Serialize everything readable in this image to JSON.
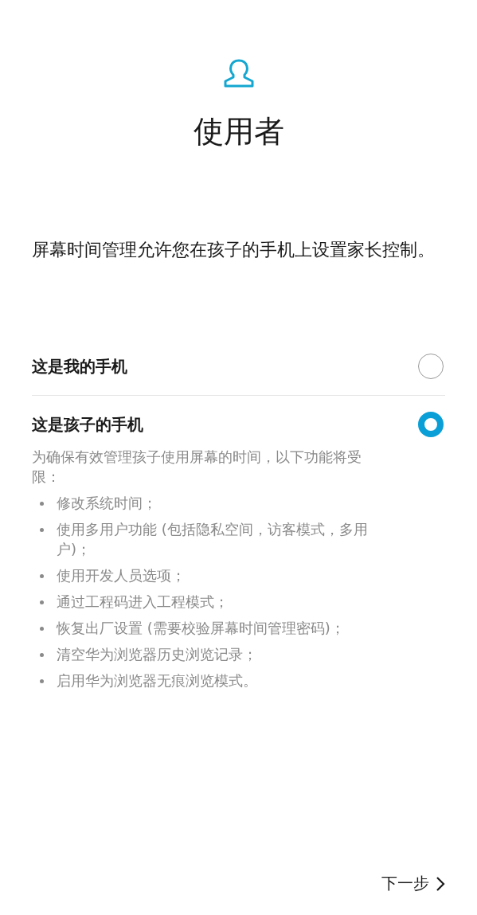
{
  "header": {
    "title": "使用者"
  },
  "intro": "屏幕时间管理允许您在孩子的手机上设置家长控制。",
  "options": [
    {
      "label": "这是我的手机",
      "selected": false
    },
    {
      "label": "这是孩子的手机",
      "selected": true,
      "note": "为确保有效管理孩子使用屏幕的时间，以下功能将受限：",
      "restrictions": [
        "修改系统时间；",
        "使用多用户功能 (包括隐私空间，访客模式，多用户)；",
        "使用开发人员选项；",
        "通过工程码进入工程模式；",
        "恢复出厂设置 (需要校验屏幕时间管理密码)；",
        "清空华为浏览器历史浏览记录；",
        "启用华为浏览器无痕浏览模式。"
      ]
    }
  ],
  "next_button": "下一步"
}
